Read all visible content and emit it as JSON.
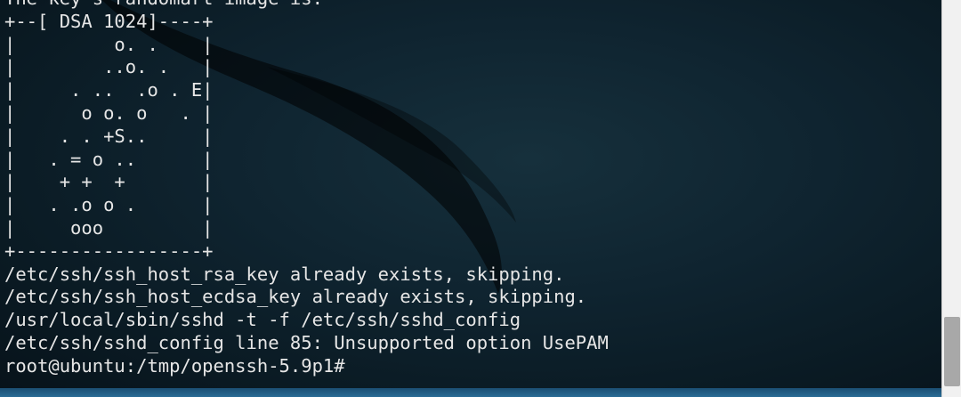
{
  "terminal": {
    "lines": [
      "The key's randomart image is:",
      "+--[ DSA 1024]----+",
      "|         o. .    |",
      "|        ..o. .   |",
      "|     . ..  .o . E|",
      "|      o o. o   . |",
      "|    . . +S..     |",
      "|   . = o ..      |",
      "|    + +  +       |",
      "|   . .o o .      |",
      "|     ooo         |",
      "+-----------------+",
      "/etc/ssh/ssh_host_rsa_key already exists, skipping.",
      "/etc/ssh/ssh_host_ecdsa_key already exists, skipping.",
      "/usr/local/sbin/sshd -t -f /etc/ssh/sshd_config",
      "/etc/ssh/sshd_config line 85: Unsupported option UsePAM",
      "root@ubuntu:/tmp/openssh-5.9p1#"
    ]
  },
  "colors": {
    "text": "#e6e6e6",
    "background": "#0f2430",
    "scrollbar_track": "#f1f1f1",
    "scrollbar_thumb": "#a8a8a8"
  }
}
